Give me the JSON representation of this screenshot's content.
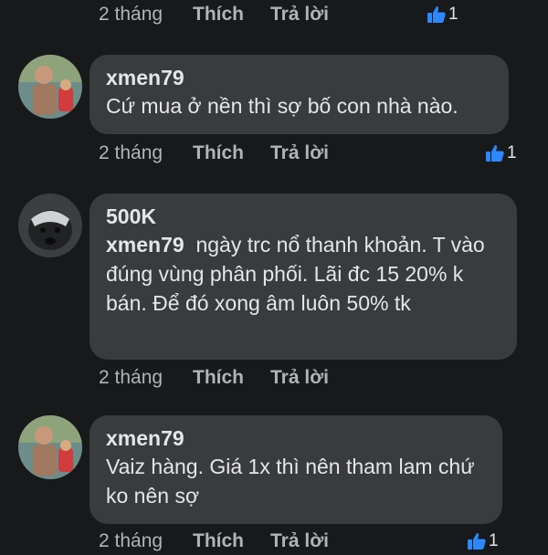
{
  "comments": [
    {
      "author": "xmen79",
      "text": "Cứ mua ở nền thì sợ bố con nhà nào.",
      "time": "2 tháng",
      "like_label": "Thích",
      "reply_label": "Trả lời",
      "reaction_count": "1"
    },
    {
      "author": "500K",
      "mention": "xmen79",
      "text": "ngày trc nổ thanh khoản. T vào đúng vùng phân phối. Lãi đc 15 20% k bán. Để đó xong âm luôn 50% tk",
      "time": "2 tháng",
      "like_label": "Thích",
      "reply_label": "Trả lời"
    },
    {
      "author": "xmen79",
      "text": "Vaiz hàng. Giá 1x thì nên tham lam chứ ko nên sợ",
      "time": "2 tháng",
      "like_label": "Thích",
      "reply_label": "Trả lời",
      "reaction_count": "1"
    }
  ],
  "previous": {
    "time": "2 tháng",
    "like_label": "Thích",
    "reply_label": "Trả lời",
    "reaction_count": "1"
  },
  "colors": {
    "background": "#18191a",
    "bubble": "#3a3b3c",
    "muted_text": "#b0b3b8",
    "like_blue": "#2d88ff"
  }
}
